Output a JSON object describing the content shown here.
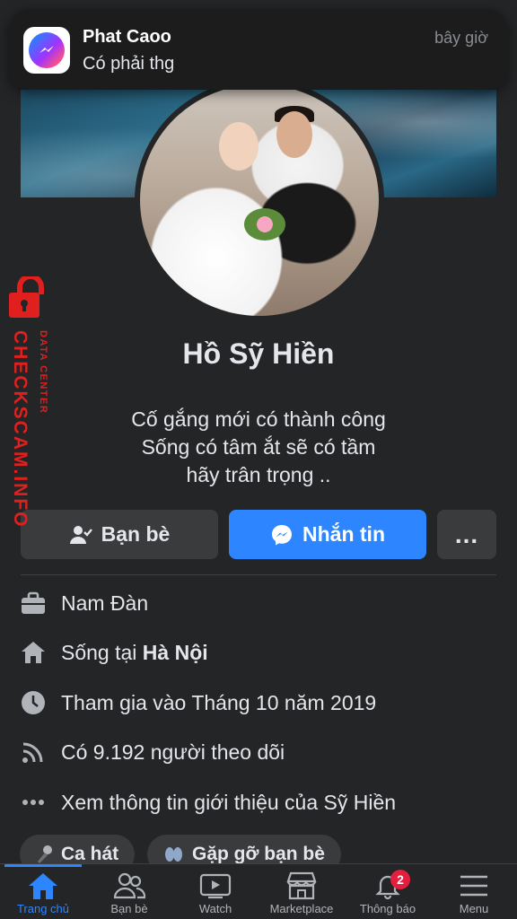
{
  "notification": {
    "sender": "Phat Caoo",
    "message": "Có phải thg",
    "time": "bây giờ",
    "app_icon": "messenger-icon"
  },
  "profile": {
    "name": "Hồ Sỹ Hiền",
    "bio": [
      "Cố gắng mới có thành công",
      "Sống có tâm ắt sẽ có tầm",
      "hãy trân trọng .."
    ]
  },
  "actions": {
    "friends_label": "Bạn bè",
    "message_label": "Nhắn tin",
    "more_label": "..."
  },
  "info": {
    "work": "Nam Đàn",
    "lives_prefix": "Sống tại ",
    "lives_city": "Hà Nội",
    "joined": "Tham gia vào Tháng 10 năm 2019",
    "followers": "Có 9.192 người theo dõi",
    "about": "Xem thông tin giới thiệu của Sỹ Hiền"
  },
  "chips": [
    {
      "label": "Ca hát",
      "icon": "microphone-icon"
    },
    {
      "label": "Gặp gỡ bạn bè",
      "icon": "people-icon"
    }
  ],
  "watermark": {
    "main": "CHECKSCAM.INFO",
    "sub": "DATA CENTER"
  },
  "tabbar": {
    "items": [
      {
        "label": "Trang chủ",
        "icon": "home-icon",
        "active": true
      },
      {
        "label": "Bạn bè",
        "icon": "friends-icon"
      },
      {
        "label": "Watch",
        "icon": "watch-icon"
      },
      {
        "label": "Marketplace",
        "icon": "marketplace-icon"
      },
      {
        "label": "Thông báo",
        "icon": "bell-icon",
        "badge": "2"
      },
      {
        "label": "Menu",
        "icon": "menu-icon"
      }
    ]
  },
  "colors": {
    "background": "#242526",
    "accent": "#2d86ff",
    "button_secondary": "#3a3b3c",
    "badge": "#e41e3f",
    "watermark": "#e0201e"
  }
}
